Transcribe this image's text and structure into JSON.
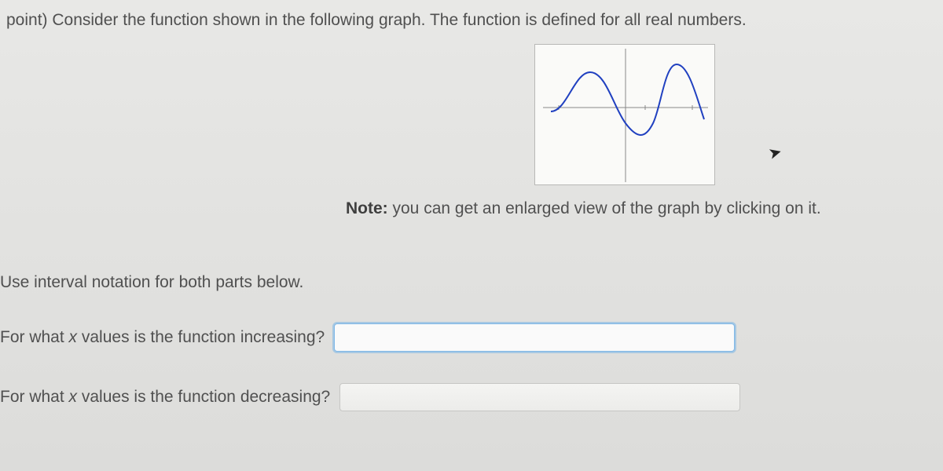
{
  "problem_intro": "point) Consider the function shown in the following graph. The function is defined for all real numbers.",
  "note_prefix": "Note:",
  "note_text": " you can get an enlarged view of the graph by clicking on it.",
  "instruction": "Use interval notation for both parts below.",
  "q1": {
    "prefix": "For what ",
    "var": "x",
    "suffix": " values is the function increasing?",
    "value": ""
  },
  "q2": {
    "prefix": "For what ",
    "var": "x",
    "suffix": " values is the function decreasing?",
    "value": ""
  }
}
